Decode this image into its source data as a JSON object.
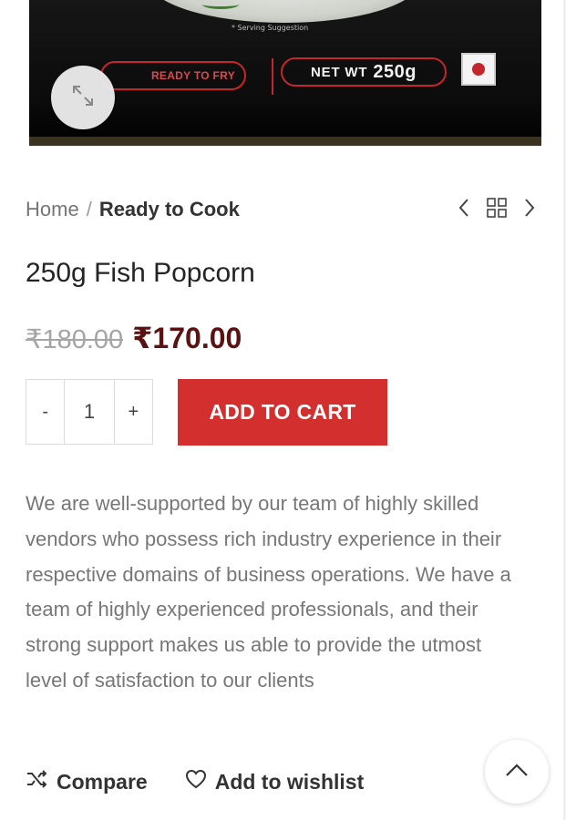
{
  "image": {
    "serving_note": "* Serving Suggestion",
    "ready_badge": "READY TO FRY",
    "net_wt_label": "NET WT",
    "net_wt_value": "250g",
    "zoom_icon": "expand-icon"
  },
  "breadcrumb": {
    "home": "Home",
    "separator": "/",
    "current": "Ready to Cook"
  },
  "product_nav": {
    "prev_icon": "chevron-left-icon",
    "grid_icon": "grid-icon",
    "next_icon": "chevron-right-icon"
  },
  "product": {
    "title": "250g Fish Popcorn",
    "old_price": "₹180.00",
    "new_price": "₹170.00",
    "quantity": "1",
    "minus": "-",
    "plus": "+",
    "add_to_cart": "ADD TO CART",
    "description": "We are well-supported by our team of highly skilled vendors who possess rich industry experience in their respective domains of business operations. We have a team of highly experienced professionals, and their strong support makes us able to provide the utmost level of satisfaction to our clients"
  },
  "actions": {
    "compare": "Compare",
    "wishlist": "Add to wishlist"
  },
  "colors": {
    "accent": "#d32f2f",
    "price": "#5a1212",
    "muted_text": "#777777"
  }
}
